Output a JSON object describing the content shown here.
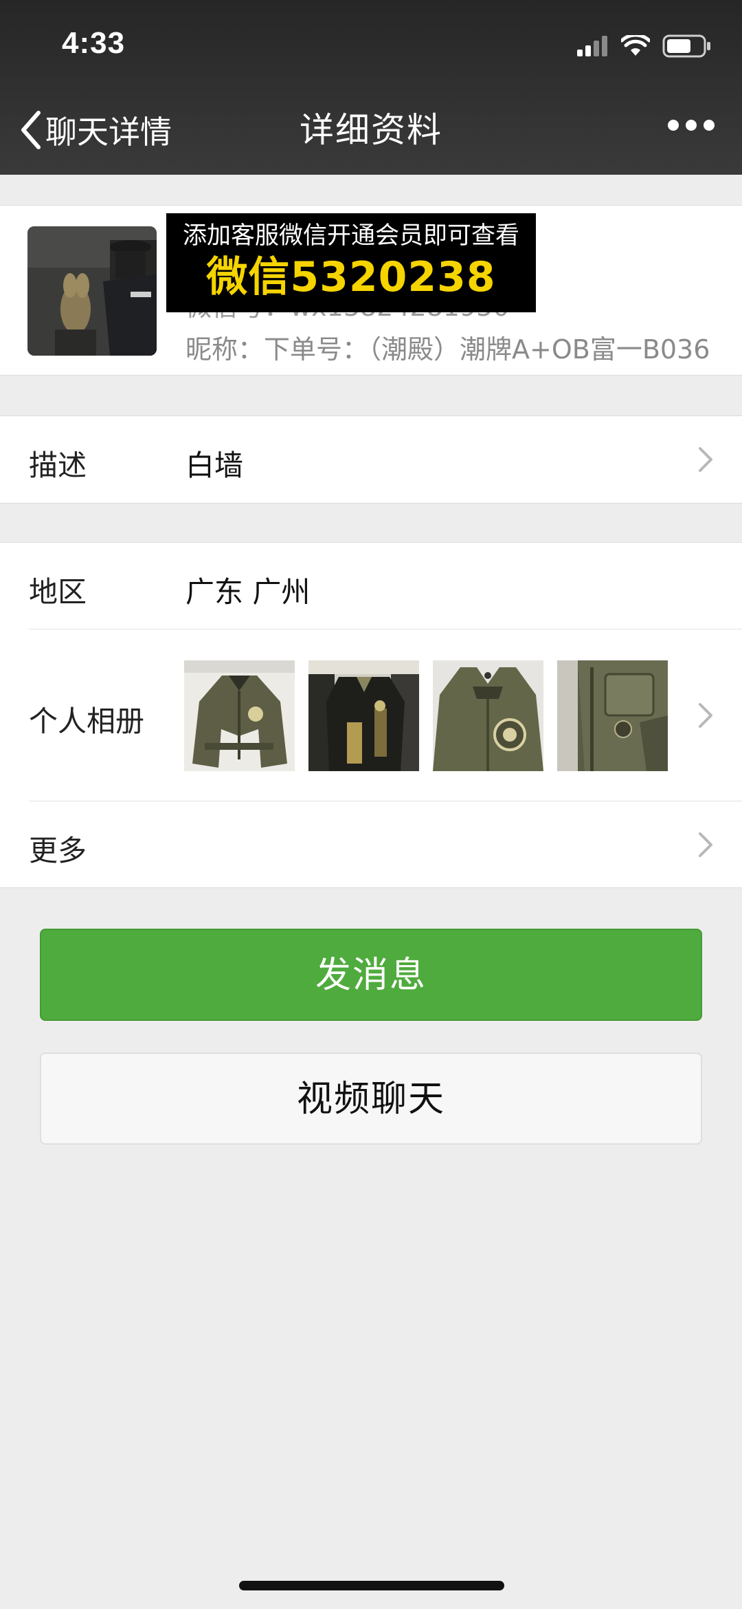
{
  "status_bar": {
    "time": "4:33"
  },
  "nav": {
    "back_label": "聊天详情",
    "title": "详细资料"
  },
  "profile": {
    "wechat_id": "微信号：wx13824281950",
    "nickname": "昵称：下单号：（潮殿）潮牌A+OB富一B036",
    "overlay_line1": "添加客服微信开通会员即可查看",
    "overlay_line2": "微信5320238"
  },
  "rows": {
    "description_label": "描述",
    "description_value": "白墙",
    "region_label": "地区",
    "region_value": "广东 广州",
    "album_label": "个人相册",
    "more_label": "更多"
  },
  "buttons": {
    "send_message": "发消息",
    "video_chat": "视频聊天"
  },
  "icons": {
    "back": "chevron-left-icon",
    "more": "more-dots-icon",
    "row_arrow": "chevron-right-icon"
  },
  "colors": {
    "primary_green": "#4fab3d",
    "navbar_bg": "#2d2d2d",
    "page_bg": "#ededed",
    "overlay_yellow": "#f5d400"
  }
}
